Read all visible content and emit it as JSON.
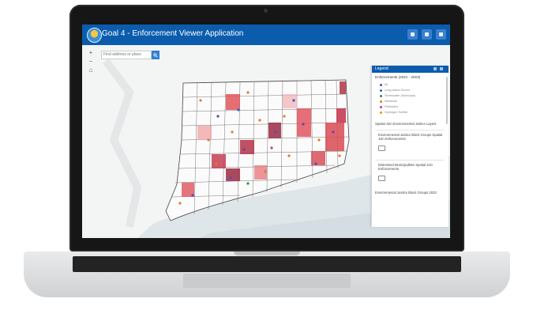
{
  "app": {
    "title": "Goal 4 - Enforcement Viewer Application",
    "header_buttons": [
      "info-icon",
      "grid-icon",
      "layers-icon"
    ],
    "accent_color": "#0b5cad"
  },
  "search": {
    "placeholder": "Find address or place"
  },
  "zoom": {
    "in_label": "+",
    "out_label": "−",
    "home_label": "⌂"
  },
  "legend": {
    "title": "Legend",
    "section_title": "Enforcements (2021 - 2023)",
    "items": [
      {
        "label": "All",
        "color": "#6a3fb5"
      },
      {
        "label": "Long Island Sound",
        "color": "#2f5fd0"
      },
      {
        "label": "Stormwater (Municipal)",
        "color": "#2e8b57"
      },
      {
        "label": "Wetlands",
        "color": "#e07b22"
      },
      {
        "label": "Pesticides",
        "color": "#c63c8e"
      },
      {
        "label": "Hydrogen Sulfide",
        "color": "#d4a017"
      }
    ],
    "subtitle": "Spatial Join Environmental Justice Layers",
    "cards": [
      {
        "title": "Environmental Justice Block Groups Spatial Join Enforcements"
      },
      {
        "title": "Distressed Municipalities Spatial Join Enforcements"
      }
    ],
    "footer": "Environmental Justice Block Groups 2023"
  }
}
